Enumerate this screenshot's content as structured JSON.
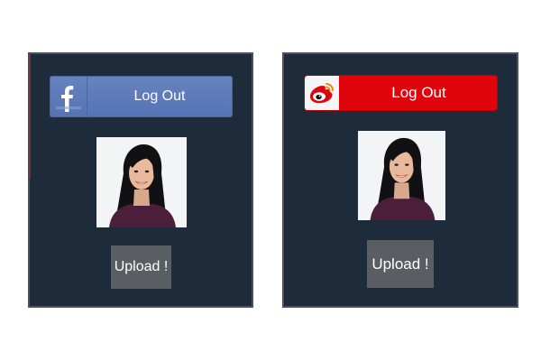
{
  "left_screen": {
    "login_button": {
      "label": "Log Out",
      "icon": "facebook-logo-icon",
      "brand_color": "#5b77b6"
    },
    "profile_photo": {
      "icon": "profile-photo"
    },
    "upload_button": {
      "label": "Upload !"
    }
  },
  "right_screen": {
    "login_button": {
      "label": "Log Out",
      "icon": "weibo-logo-icon",
      "brand_color": "#e0050d"
    },
    "profile_photo": {
      "icon": "profile-photo"
    },
    "upload_button": {
      "label": "Upload !"
    }
  },
  "colors": {
    "screen_background": "#1e2b3b",
    "upload_button": "#5a5e63"
  }
}
